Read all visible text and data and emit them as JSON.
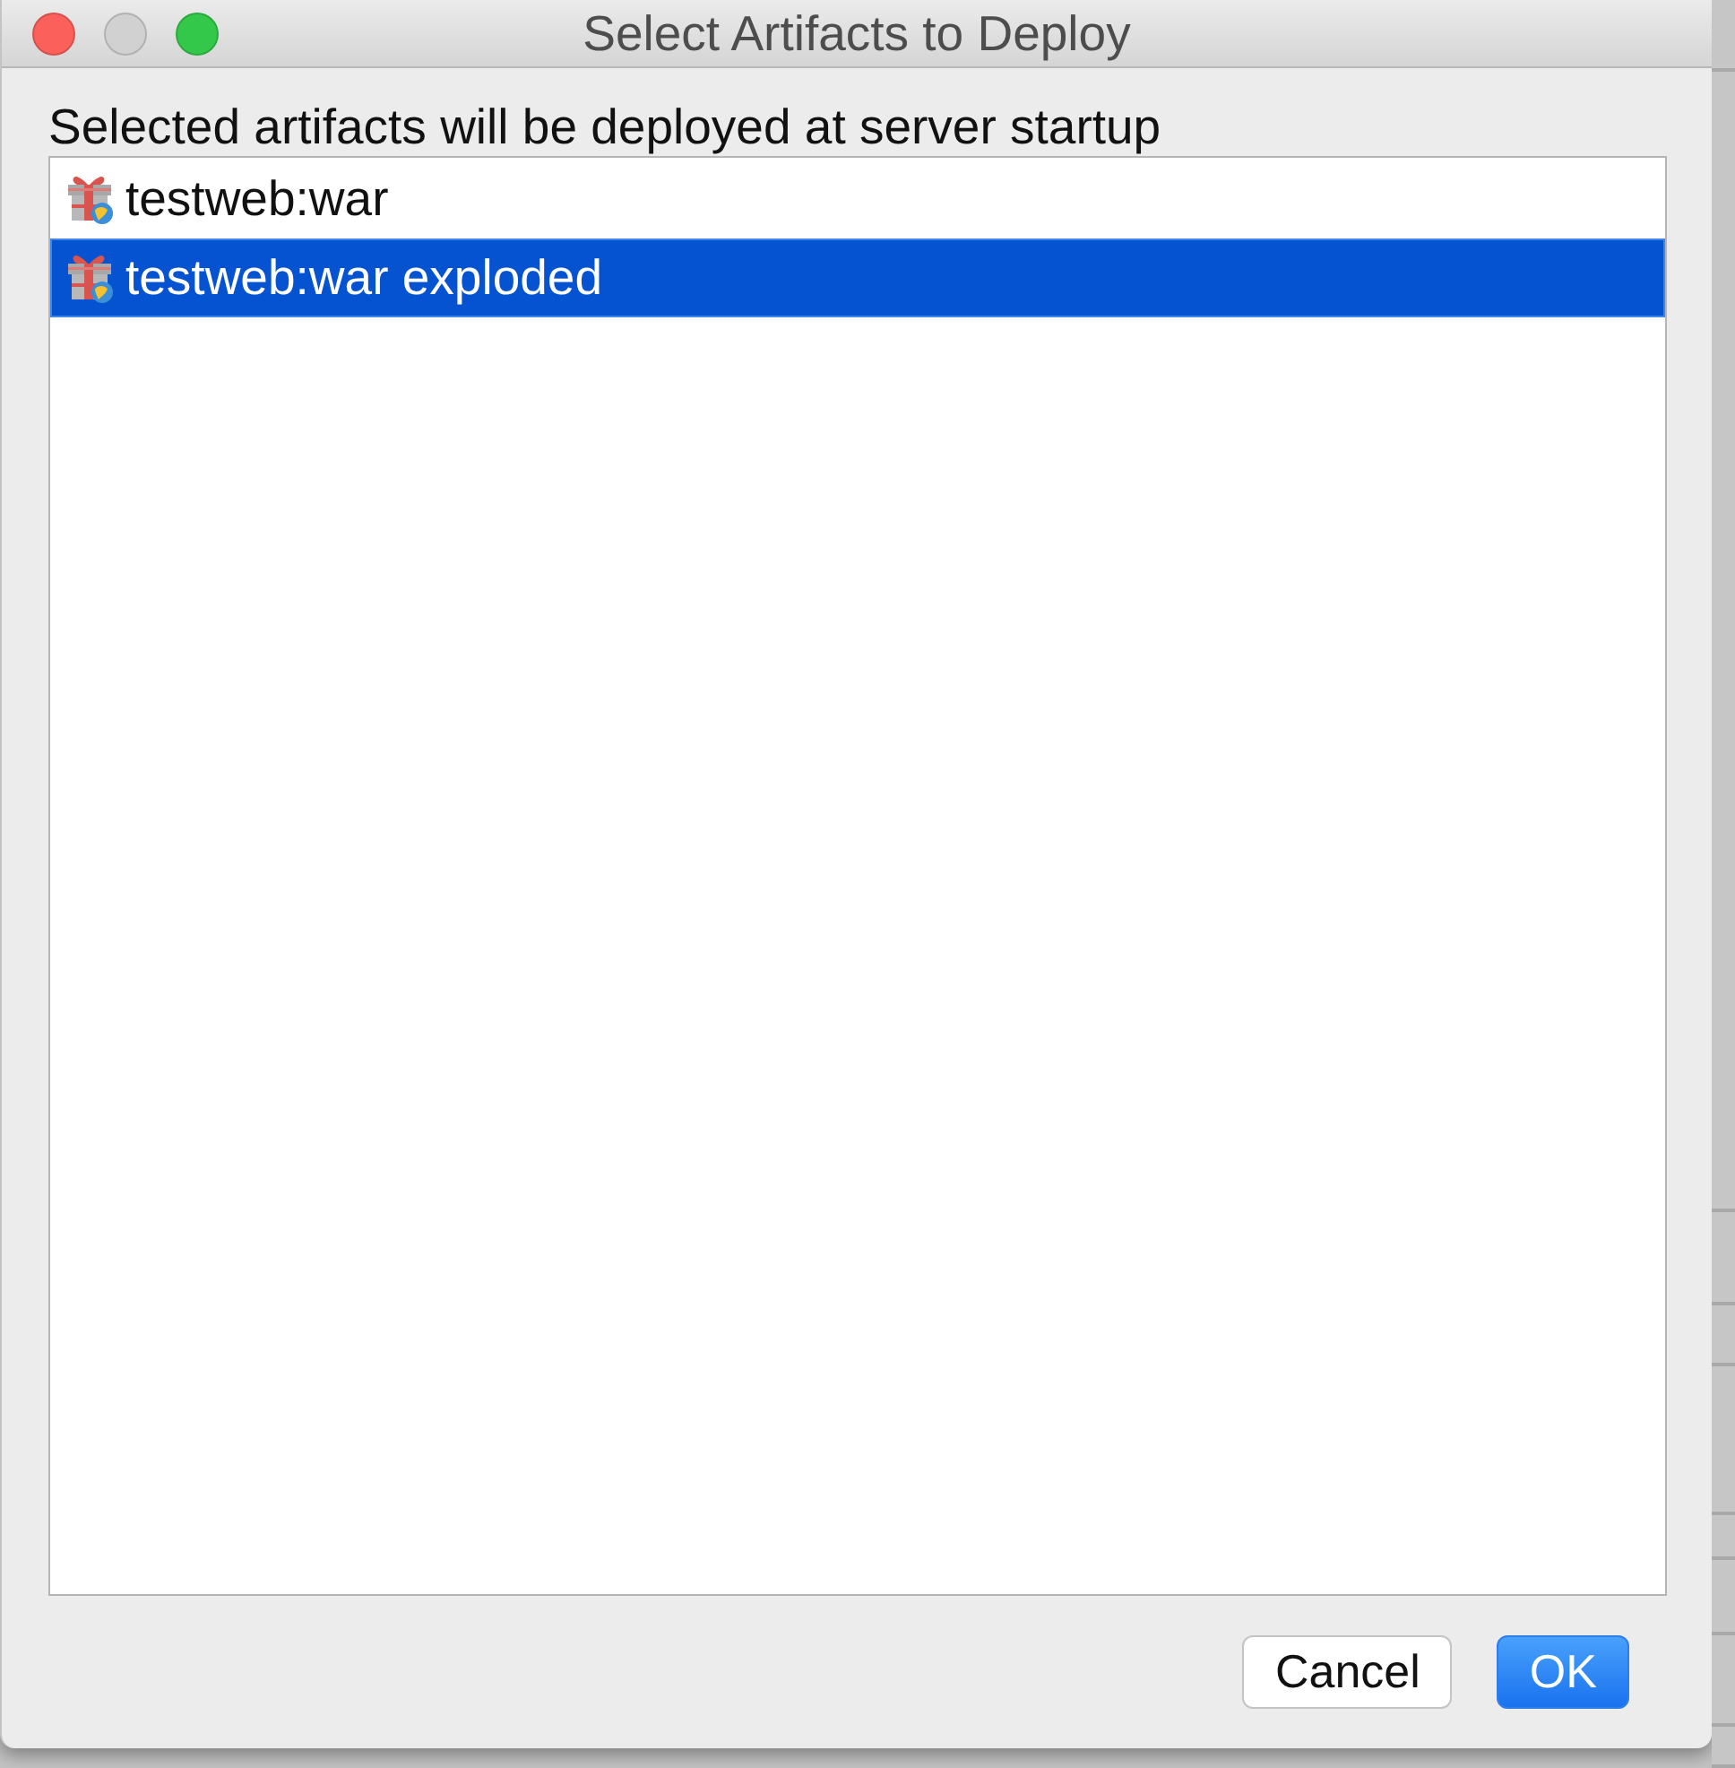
{
  "window": {
    "title": "Select Artifacts to Deploy",
    "controls": [
      {
        "kind": "close",
        "disabled": false
      },
      {
        "kind": "minimize",
        "disabled": true
      },
      {
        "kind": "zoom",
        "disabled": false
      }
    ]
  },
  "label": "Selected artifacts will be deployed at server startup",
  "artifacts": [
    {
      "name": "testweb:war",
      "selected": false
    },
    {
      "name": "testweb:war exploded",
      "selected": true
    }
  ],
  "buttons": [
    {
      "label": "Cancel",
      "kind": "secondary"
    },
    {
      "label": "OK",
      "kind": "default"
    }
  ]
}
